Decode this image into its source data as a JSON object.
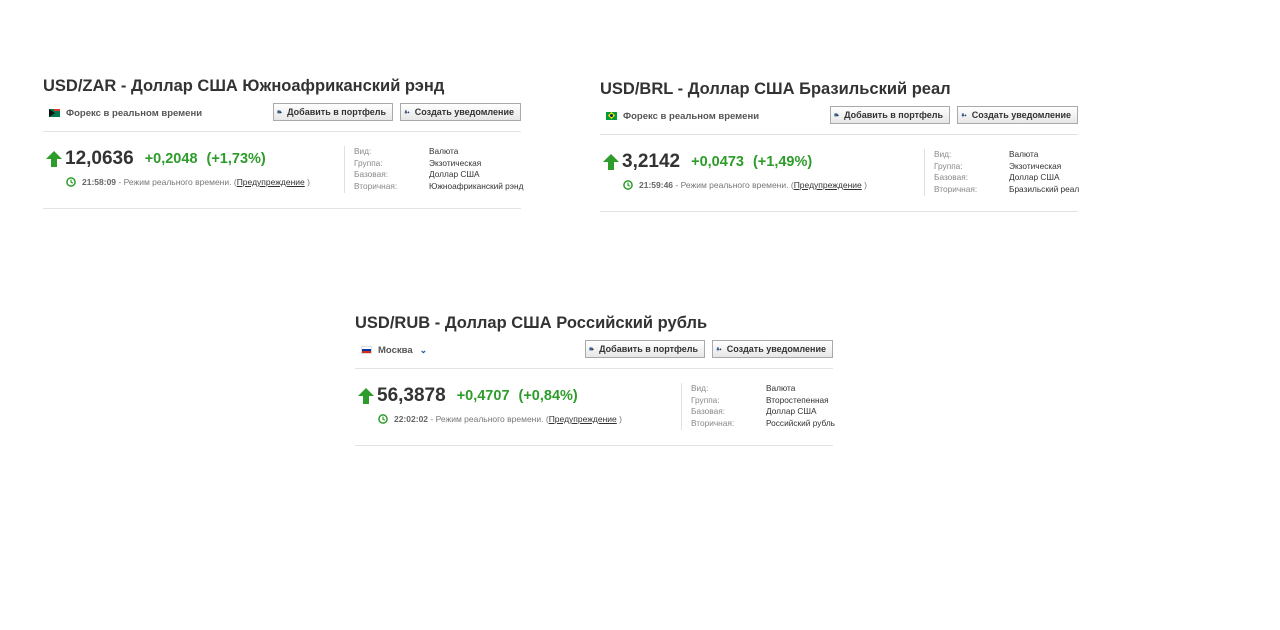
{
  "widgets": [
    {
      "title": "USD/ZAR - Доллар США Южноафриканский рэнд",
      "source_label": "Форекс в реальном времени",
      "flag": "south-africa-flag",
      "last": "12,0636",
      "change": "+0,2048",
      "change_pct": "(+1,73%)",
      "direction": "up",
      "time": "21:58:09",
      "time_suffix": " - Режим реального времени. (",
      "warning_link": "Предупреждение",
      "time_close": " )",
      "info": [
        {
          "key": "Вид:",
          "value": "Валюта"
        },
        {
          "key": "Группа:",
          "value": "Экзотическая"
        },
        {
          "key": "Базовая:",
          "value": "Доллар США"
        },
        {
          "key": "Вторичная:",
          "value": "Южноафриканский рэнд"
        }
      ]
    },
    {
      "title": "USD/BRL - Доллар США Бразильский реал",
      "source_label": "Форекс в реальном времени",
      "flag": "brazil-flag",
      "last": "3,2142",
      "change": "+0,0473",
      "change_pct": "(+1,49%)",
      "direction": "up",
      "time": "21:59:46",
      "time_suffix": " - Режим реального времени. (",
      "warning_link": "Предупреждение",
      "time_close": " )",
      "info": [
        {
          "key": "Вид:",
          "value": "Валюта"
        },
        {
          "key": "Группа:",
          "value": "Экзотическая"
        },
        {
          "key": "Базовая:",
          "value": "Доллар США"
        },
        {
          "key": "Вторичная:",
          "value": "Бразильский реал"
        }
      ]
    },
    {
      "title": "USD/RUB - Доллар США Российский рубль",
      "source_label": "Москва",
      "flag": "russia-flag",
      "last": "56,3878",
      "change": "+0,4707",
      "change_pct": "(+0,84%)",
      "direction": "up",
      "time": "22:02:02",
      "time_suffix": " - Режим реального времени. (",
      "warning_link": "Предупреждение",
      "time_close": " )",
      "info": [
        {
          "key": "Вид:",
          "value": "Валюта"
        },
        {
          "key": "Группа:",
          "value": "Второстепенная"
        },
        {
          "key": "Базовая:",
          "value": "Доллар США"
        },
        {
          "key": "Вторичная:",
          "value": "Российский рубль"
        }
      ]
    }
  ],
  "buttons": {
    "add_portfolio": "Добавить в портфель",
    "create_alert": "Создать уведомление"
  },
  "icons": {
    "portfolio": "add-portfolio-icon",
    "alert": "alert-bell-icon",
    "arrow": "up-arrow-icon",
    "clock": "clock-icon",
    "dropdown": "chevron-down-icon"
  },
  "colors": {
    "positive": "#2d9c2a",
    "link": "#1e5aa8"
  }
}
